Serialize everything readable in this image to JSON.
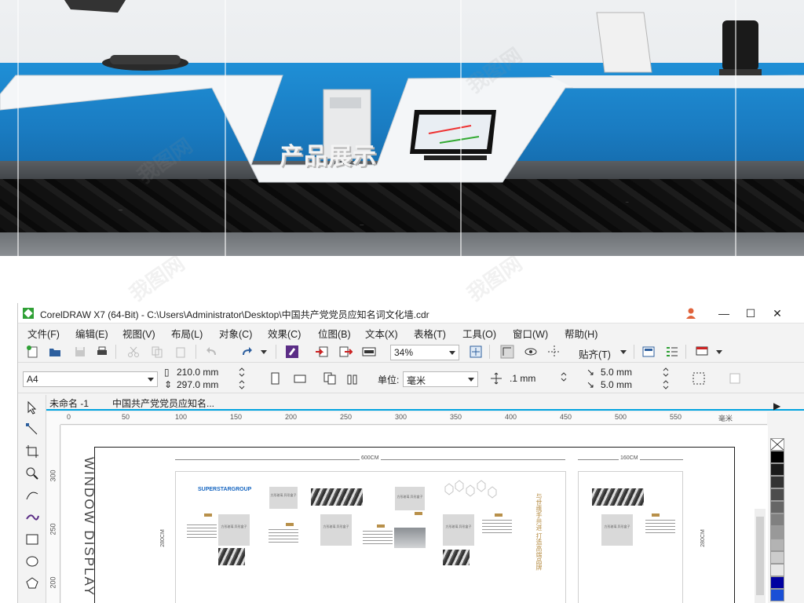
{
  "watermark": "我图网",
  "photo": {
    "brand_text": "产品展示"
  },
  "window": {
    "title": "CorelDRAW X7 (64-Bit) - C:\\Users\\Administrator\\Desktop\\中国共产党党员应知名词文化墙.cdr",
    "controls": {
      "minimize": "—",
      "maximize": "☐",
      "close": "✕"
    }
  },
  "menu": [
    "文件(F)",
    "编辑(E)",
    "视图(V)",
    "布局(L)",
    "对象(C)",
    "效果(C)",
    "位图(B)",
    "文本(X)",
    "表格(T)",
    "工具(O)",
    "窗口(W)",
    "帮助(H)"
  ],
  "toolbar": {
    "zoom": "34%",
    "align_label": "贴齐(T)"
  },
  "propbar": {
    "page_size": "A4",
    "width": "210.0 mm",
    "height": "297.0 mm",
    "unit_label": "单位:",
    "unit_value": "毫米",
    "nudge": ".1 mm",
    "dup_x": "5.0 mm",
    "dup_y": "5.0 mm"
  },
  "doc_tabs": [
    "未命名 -1",
    "中国共产党党员应知名..."
  ],
  "ruler": {
    "top": [
      "0",
      "50",
      "100",
      "150",
      "200",
      "250",
      "300",
      "350",
      "400",
      "450",
      "500",
      "550"
    ],
    "unit": "毫米",
    "left": [
      "300",
      "250",
      "200"
    ]
  },
  "canvas": {
    "vertical_title": "WINDOW DISPLAY",
    "dim_main": "600CM",
    "dim_side": "160CM",
    "dim_height": "280CM",
    "logo": "SUPERSTARGROUP",
    "placeholder": "方形玻璃\n异形盒子",
    "slogan": "与世携手共进 打造高端品牌"
  },
  "palette": [
    "#ffffff",
    "#000000",
    "#1a1a1a",
    "#333333",
    "#4d4d4d",
    "#666666",
    "#808080",
    "#999999",
    "#b3b3b3",
    "#cccccc",
    "#e6e6e6",
    "#0000a0",
    "#1a4fd6"
  ]
}
